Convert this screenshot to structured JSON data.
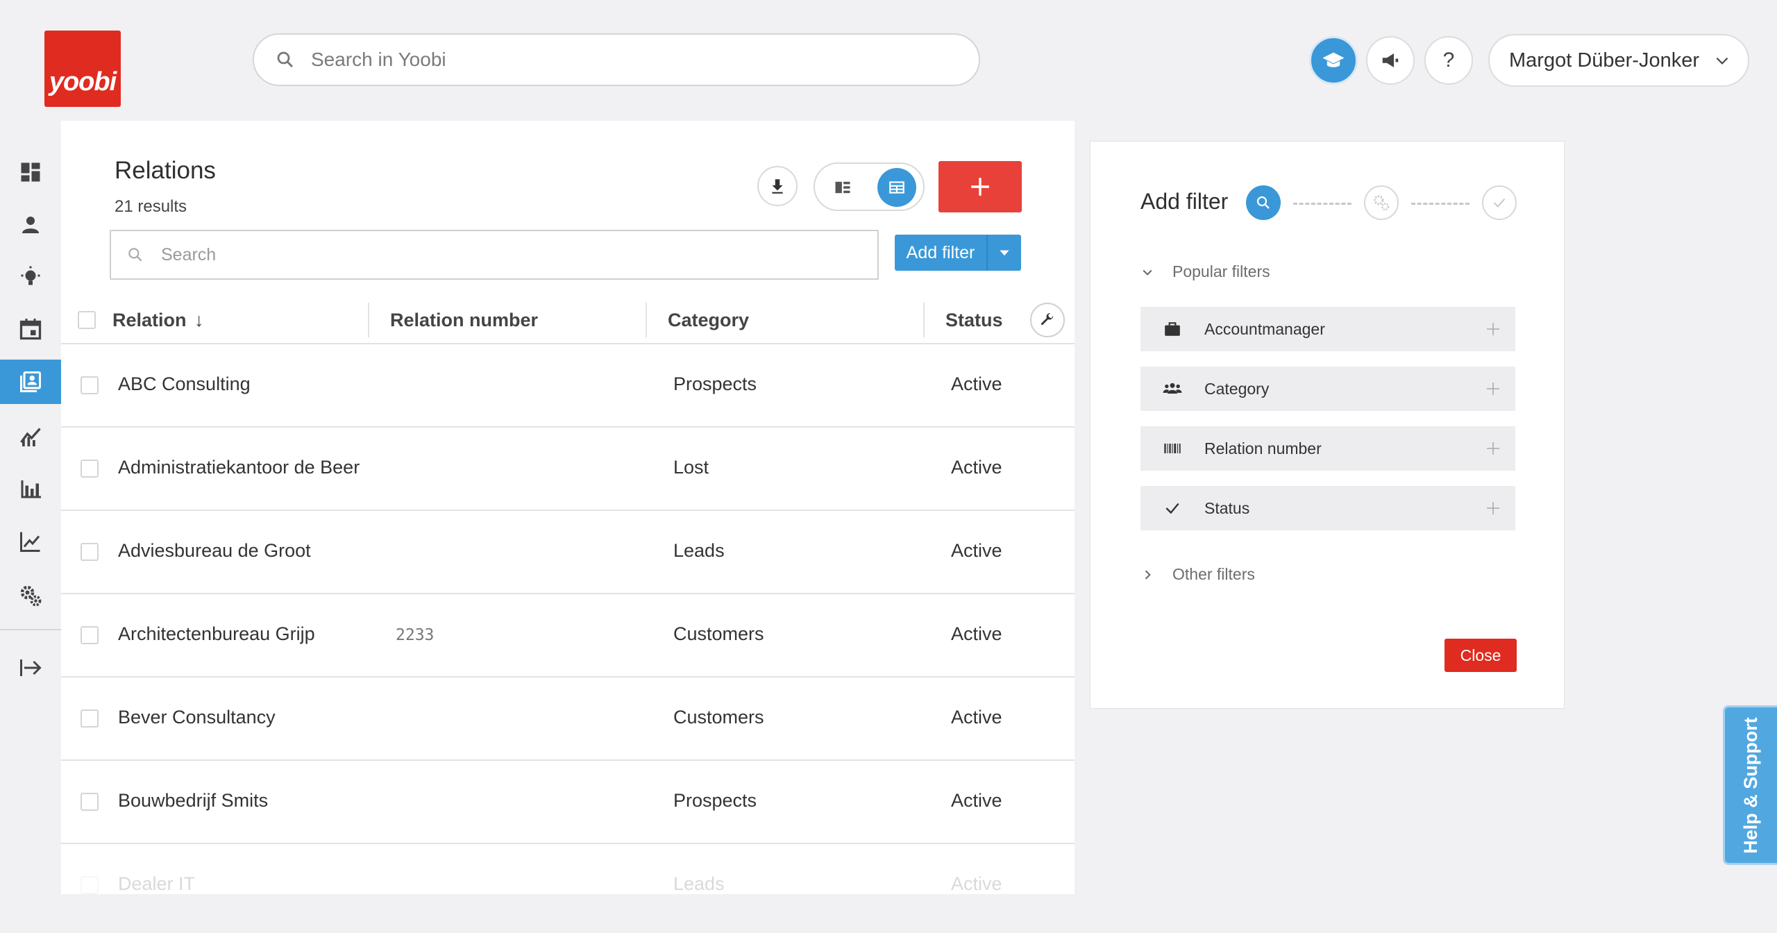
{
  "brand": {
    "logo_text": "yoobi",
    "color": "#e02b20"
  },
  "top_search": {
    "placeholder": "Search in Yoobi"
  },
  "topbar": {
    "help_glyph": "?",
    "user_name": "Margot Düber-Jonker",
    "icons": [
      "academy-icon",
      "announcement-icon",
      "question-icon",
      "chevron-down-icon"
    ]
  },
  "sidebar": {
    "items": [
      {
        "icon": "dashboard-icon"
      },
      {
        "icon": "person-icon"
      },
      {
        "icon": "lightbulb-icon"
      },
      {
        "icon": "calendar-icon"
      },
      {
        "icon": "relations-icon",
        "active": true
      },
      {
        "icon": "trend-icon"
      },
      {
        "icon": "bar-chart-icon"
      },
      {
        "icon": "line-chart-icon"
      },
      {
        "icon": "settings-icon"
      },
      {
        "icon": "logout-icon"
      }
    ],
    "accent": "#3a98d8"
  },
  "relations": {
    "title": "Relations",
    "results": "21 results",
    "search_placeholder": "Search",
    "add_filter_label": "Add filter",
    "add_button_glyph": "+",
    "columns": [
      "Relation",
      "Relation number",
      "Category",
      "Status"
    ],
    "sort_indicator": "↓",
    "rows": [
      {
        "name": "ABC Consulting",
        "number": "",
        "category": "Prospects",
        "status": "Active"
      },
      {
        "name": "Administratiekantoor de Beer",
        "number": "",
        "category": "Lost",
        "status": "Active"
      },
      {
        "name": "Adviesbureau de Groot",
        "number": "",
        "category": "Leads",
        "status": "Active"
      },
      {
        "name": "Architectenbureau Grijp",
        "number": "2233",
        "category": "Customers",
        "status": "Active"
      },
      {
        "name": "Bever Consultancy",
        "number": "",
        "category": "Customers",
        "status": "Active"
      },
      {
        "name": "Bouwbedrijf Smits",
        "number": "",
        "category": "Prospects",
        "status": "Active"
      },
      {
        "name": "Dealer IT",
        "number": "",
        "category": "Leads",
        "status": "Active"
      }
    ]
  },
  "filter_panel": {
    "title": "Add filter",
    "popular_label": "Popular filters",
    "popular": [
      {
        "label": "Accountmanager",
        "icon": "briefcase-icon"
      },
      {
        "label": "Category",
        "icon": "people-icon"
      },
      {
        "label": "Relation number",
        "icon": "barcode-icon"
      },
      {
        "label": "Status",
        "icon": "check-icon"
      }
    ],
    "other_label": "Other filters",
    "close_label": "Close"
  },
  "help_tab": {
    "label": "Help & Support"
  }
}
